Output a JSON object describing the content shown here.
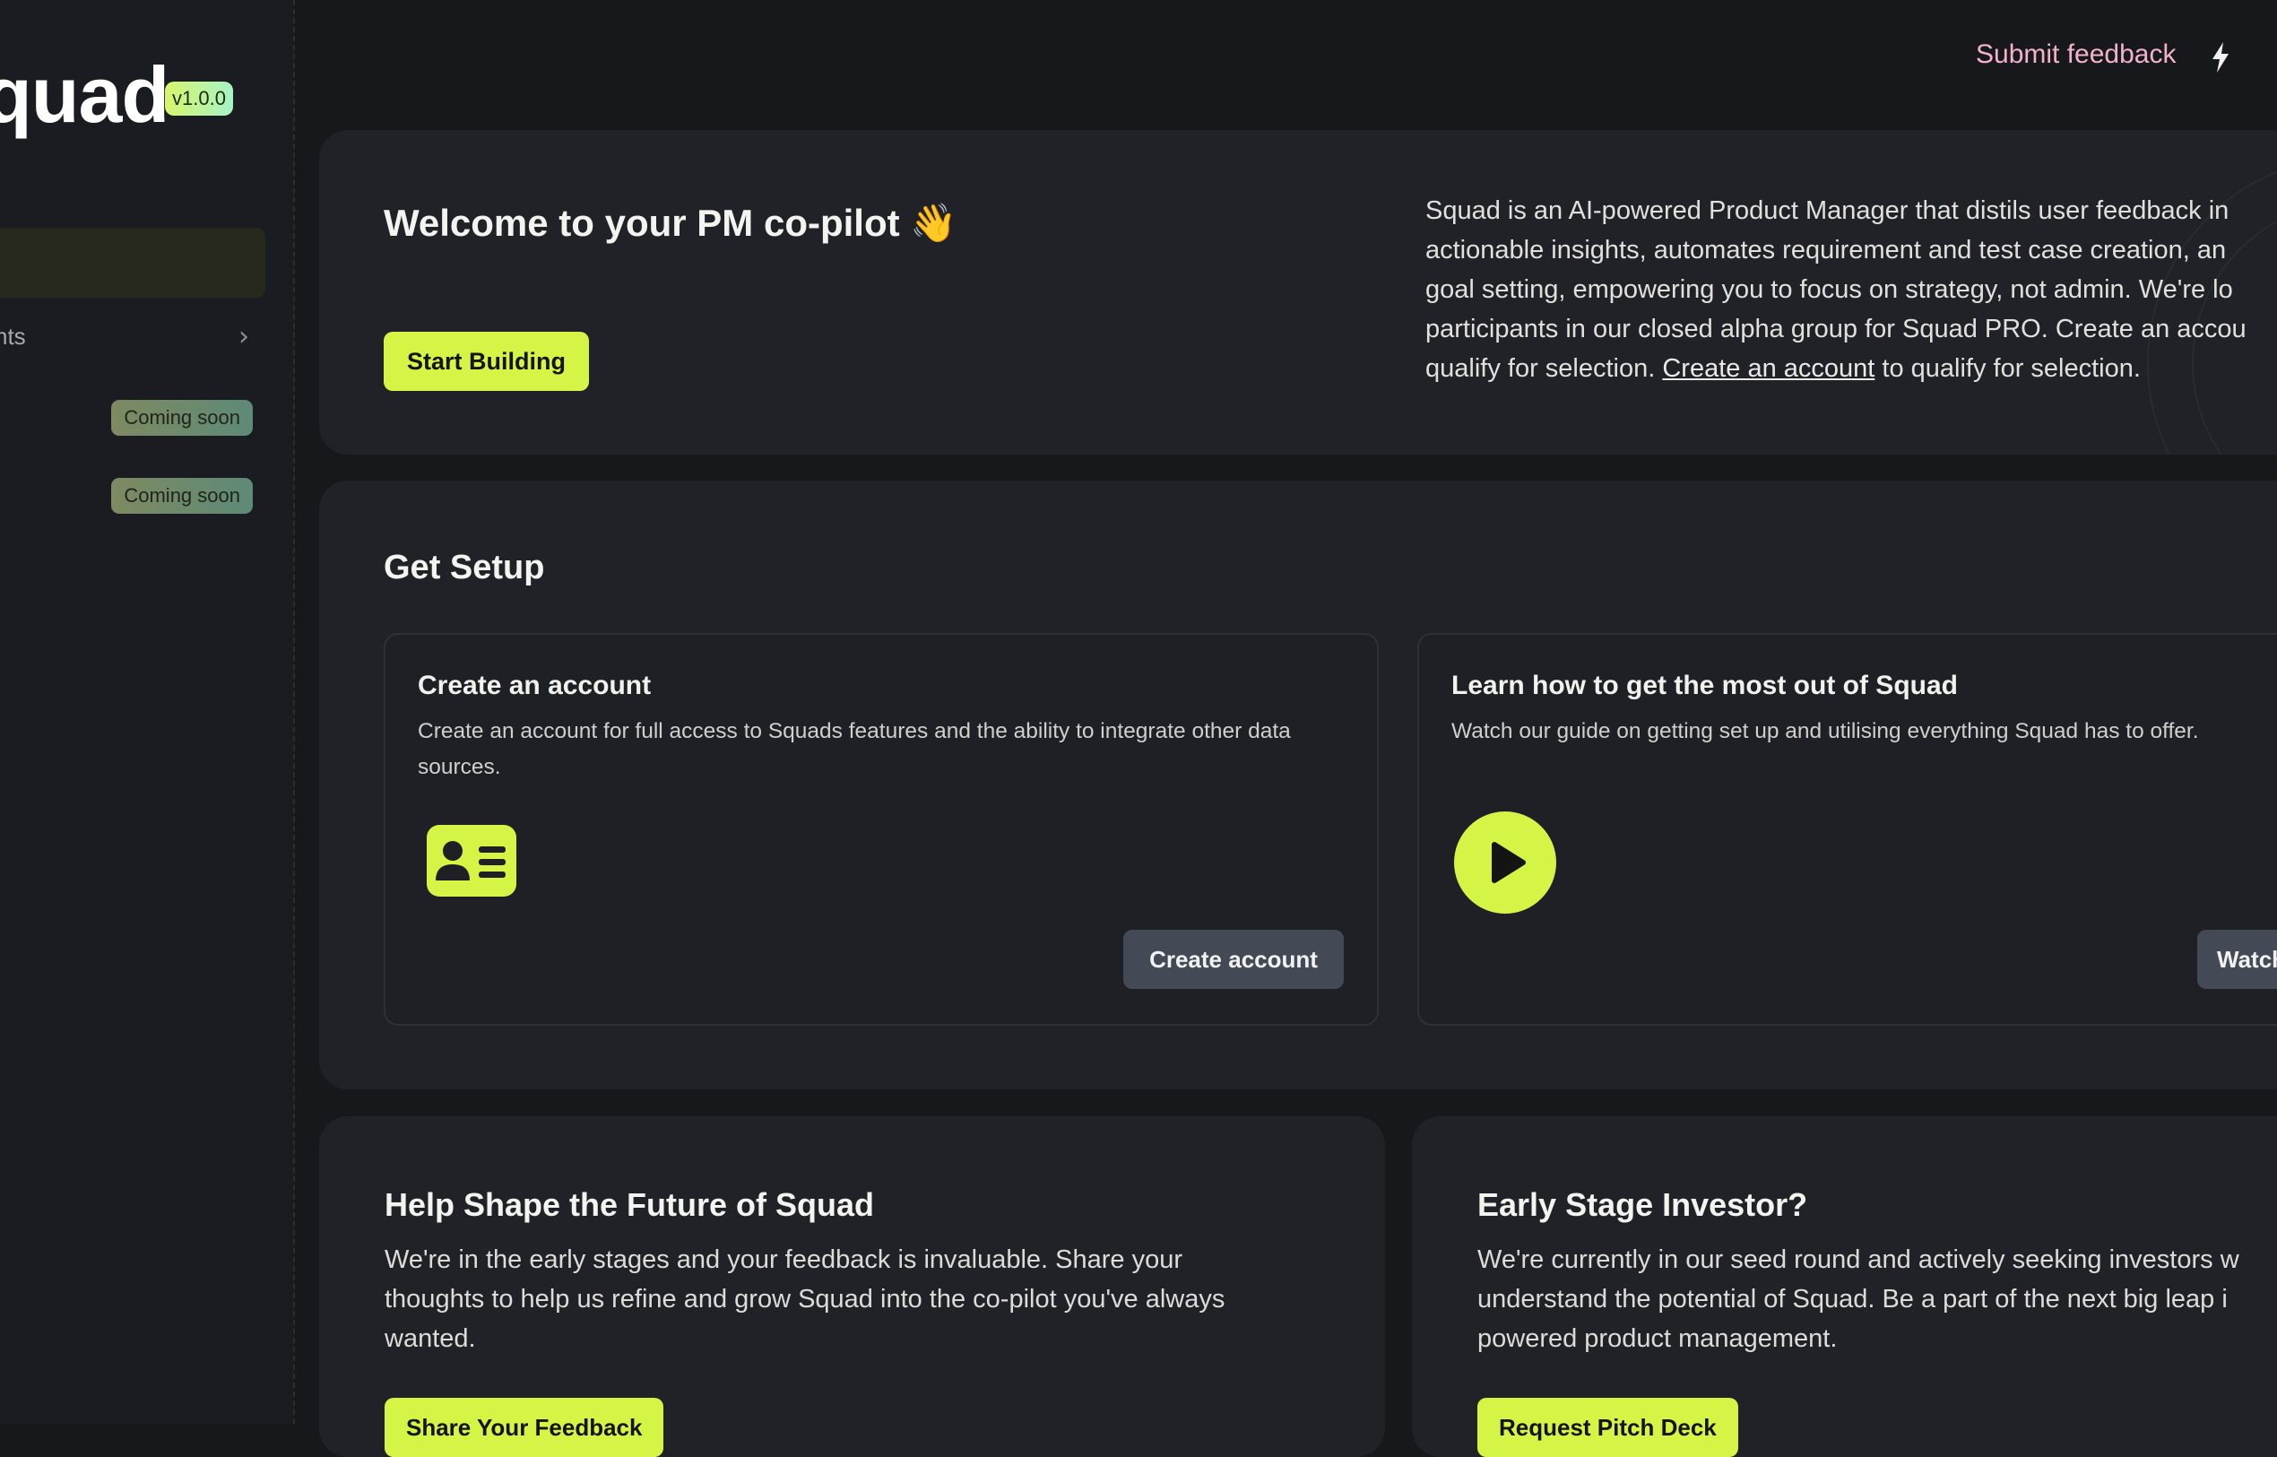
{
  "sidebar": {
    "logo": "quad",
    "version": "v1.0.0",
    "nav_partial_label": "nts",
    "badges": [
      "Coming soon",
      "Coming soon"
    ]
  },
  "topbar": {
    "feedback_label": "Submit feedback",
    "feedback_icon": "lightning-bolt-icon"
  },
  "welcome": {
    "title": "Welcome to your PM co-pilot 👋",
    "button": "Start Building",
    "text_lines": [
      "Squad is an AI-powered Product Manager that distils user feedback in",
      "actionable insights, automates requirement and test case creation, an",
      "goal setting, empowering you to focus on strategy, not admin. We're lo",
      "participants in our closed alpha group for Squad PRO. Create an accou"
    ],
    "text_last_prefix": "qualify for selection. ",
    "text_link": "Create an account",
    "text_last_suffix": " to qualify for selection."
  },
  "setup": {
    "title": "Get Setup",
    "account_card": {
      "title": "Create an account",
      "desc": "Create an account for full access to Squads features and the ability to integrate other data sources.",
      "icon": "id-card-icon",
      "button": "Create account"
    },
    "guide_card": {
      "title": "Learn how to get the most out of Squad",
      "desc": "Watch our guide on getting set up and utilising everything Squad has to offer.",
      "icon": "play-icon",
      "button": "Watch"
    }
  },
  "help": {
    "title": "Help Shape the Future of Squad",
    "text_lines": [
      "We're in the early stages and your feedback is invaluable. Share your",
      "thoughts to help us refine and grow Squad into the co-pilot you've always",
      "wanted."
    ],
    "button": "Share Your Feedback"
  },
  "investor": {
    "title": "Early Stage Investor?",
    "text_lines": [
      "We're currently in our seed round and actively seeking investors w",
      "understand the potential of Squad. Be a part of the next big leap i",
      "powered product management."
    ],
    "button": "Request Pitch Deck"
  },
  "colors": {
    "accent": "#d4f545",
    "background": "#17181c",
    "card": "#212227",
    "feedback_link": "#f2b3c8"
  }
}
